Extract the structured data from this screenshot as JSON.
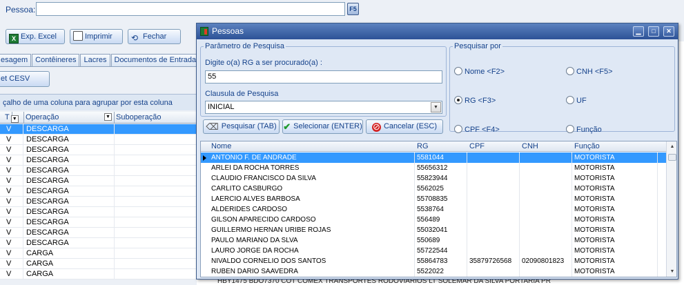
{
  "topbar": {
    "pessoa_label": "Pessoa:",
    "pessoa_value": "",
    "f5_label": "F5"
  },
  "toolbar": {
    "excel_label": "Exp. Excel",
    "print_label": "Imprimir",
    "close_label": "Fechar"
  },
  "tabs": [
    "esagem",
    "Contêineres",
    "Lacres",
    "Documentos de Entrada"
  ],
  "cesv_button": "et CESV",
  "group_hint": "çalho de uma coluna para agrupar por esta coluna",
  "bg_grid": {
    "headers": {
      "t": "T",
      "operacao": "Operação",
      "suboperacao": "Suboperação"
    },
    "rows": [
      {
        "t": "V",
        "op": "DESCARGA"
      },
      {
        "t": "V",
        "op": "DESCARGA"
      },
      {
        "t": "V",
        "op": "DESCARGA"
      },
      {
        "t": "V",
        "op": "DESCARGA"
      },
      {
        "t": "V",
        "op": "DESCARGA"
      },
      {
        "t": "V",
        "op": "DESCARGA"
      },
      {
        "t": "V",
        "op": "DESCARGA"
      },
      {
        "t": "V",
        "op": "DESCARGA"
      },
      {
        "t": "V",
        "op": "DESCARGA"
      },
      {
        "t": "V",
        "op": "DESCARGA"
      },
      {
        "t": "V",
        "op": "DESCARGA"
      },
      {
        "t": "V",
        "op": "DESCARGA"
      },
      {
        "t": "V",
        "op": "CARGA"
      },
      {
        "t": "V",
        "op": "CARGA"
      },
      {
        "t": "V",
        "op": "CARGA"
      }
    ],
    "bottom_text": "HBY1475     BDO7370     COT COMEX TRANSPORTES RODOVIARIOS LT     SOLEMAR DA SILVA                               PORTARIA PR"
  },
  "dialog": {
    "title": "Pessoas",
    "param_legend": "Parâmetro de Pesquisa",
    "search_label": "Digite o(a) RG a ser procurado(a) :",
    "search_value": "55",
    "clause_label": "Clausula de Pesquisa",
    "clause_value": "INICIAL",
    "searchby_legend": "Pesquisar por",
    "radios": {
      "nome": "Nome   <F2>",
      "cnh": "CNH   <F5>",
      "rg": "RG   <F3>",
      "uf": "UF",
      "cpf": "CPF   <F4>",
      "funcao": "Função"
    },
    "selected_radio": "rg",
    "buttons": {
      "pesquisar": "Pesquisar (TAB)",
      "selecionar": "Selecionar (ENTER)",
      "cancelar": "Cancelar (ESC)"
    },
    "grid": {
      "headers": {
        "nome": "Nome",
        "rg": "RG",
        "cpf": "CPF",
        "cnh": "CNH",
        "funcao": "Função"
      },
      "rows": [
        {
          "nome": "ANTONIO F. DE ANDRADE",
          "rg": "5581044",
          "cpf": "",
          "cnh": "",
          "funcao": "MOTORISTA"
        },
        {
          "nome": "ARLEI DA ROCHA TORRES",
          "rg": "55656312",
          "cpf": "",
          "cnh": "",
          "funcao": "MOTORISTA"
        },
        {
          "nome": "CLAUDIO FRANCISCO DA SILVA",
          "rg": "55823944",
          "cpf": "",
          "cnh": "",
          "funcao": "MOTORISTA"
        },
        {
          "nome": "CARLITO CASBURGO",
          "rg": "5562025",
          "cpf": "",
          "cnh": "",
          "funcao": "MOTORISTA"
        },
        {
          "nome": "LAERCIO ALVES BARBOSA",
          "rg": "55708835",
          "cpf": "",
          "cnh": "",
          "funcao": "MOTORISTA"
        },
        {
          "nome": "ALDERIDES CARDOSO",
          "rg": "5538764",
          "cpf": "",
          "cnh": "",
          "funcao": "MOTORISTA"
        },
        {
          "nome": "GILSON APARECIDO CARDOSO",
          "rg": "556489",
          "cpf": "",
          "cnh": "",
          "funcao": "MOTORISTA"
        },
        {
          "nome": "GUILLERMO HERNAN URIBE ROJAS",
          "rg": "55032041",
          "cpf": "",
          "cnh": "",
          "funcao": "MOTORISTA"
        },
        {
          "nome": "PAULO MARIANO DA SLVA",
          "rg": "550689",
          "cpf": "",
          "cnh": "",
          "funcao": "MOTORISTA"
        },
        {
          "nome": "LAURO JORGE DA ROCHA",
          "rg": "55722544",
          "cpf": "",
          "cnh": "",
          "funcao": "MOTORISTA"
        },
        {
          "nome": "NIVALDO CORNELIO DOS SANTOS",
          "rg": "55864783",
          "cpf": "35879726568",
          "cnh": "02090801823",
          "funcao": "MOTORISTA"
        },
        {
          "nome": "RUBEN DARIO SAAVEDRA",
          "rg": "5522022",
          "cpf": "",
          "cnh": "",
          "funcao": "MOTORISTA"
        }
      ]
    }
  },
  "colors": {
    "title_bar": "#2d5297",
    "selection": "#3399ff",
    "label": "#15428b"
  }
}
